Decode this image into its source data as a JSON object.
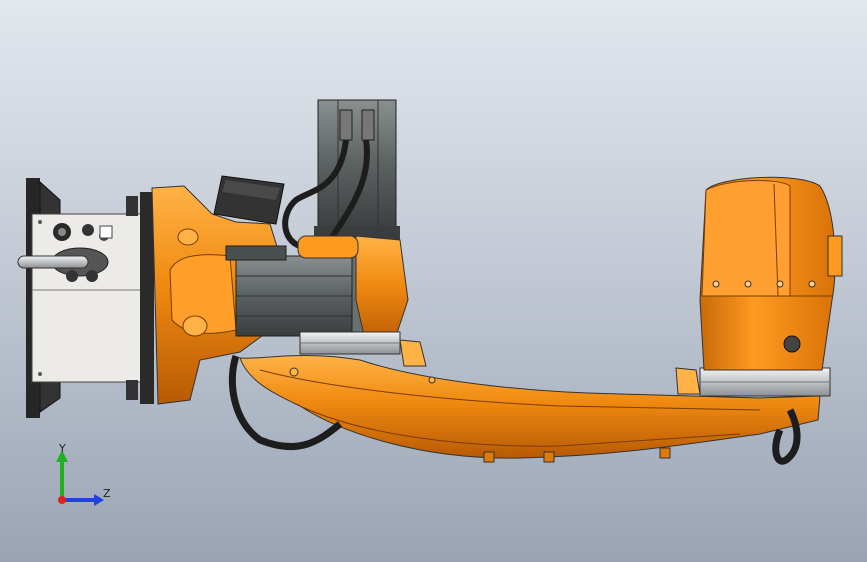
{
  "viewport": {
    "background_top": "#e3e7ee",
    "background_bottom": "#9aa4b4"
  },
  "colors": {
    "body_orange": "#f08a10",
    "body_highlight": "#ffb347",
    "body_shadow": "#b85a05",
    "motor_grey": "#5a5f5f",
    "motor_dark": "#3a3d3d",
    "plate_white": "#ecebe7",
    "flange_black": "#262626",
    "cable_black": "#1d1d1d",
    "axis_x": "#e02020",
    "axis_y": "#20b020",
    "axis_z": "#2040e0"
  },
  "triad": {
    "y_label": "Y",
    "z_label": "Z"
  },
  "icons": {
    "triad": "coordinate-triad-icon"
  }
}
